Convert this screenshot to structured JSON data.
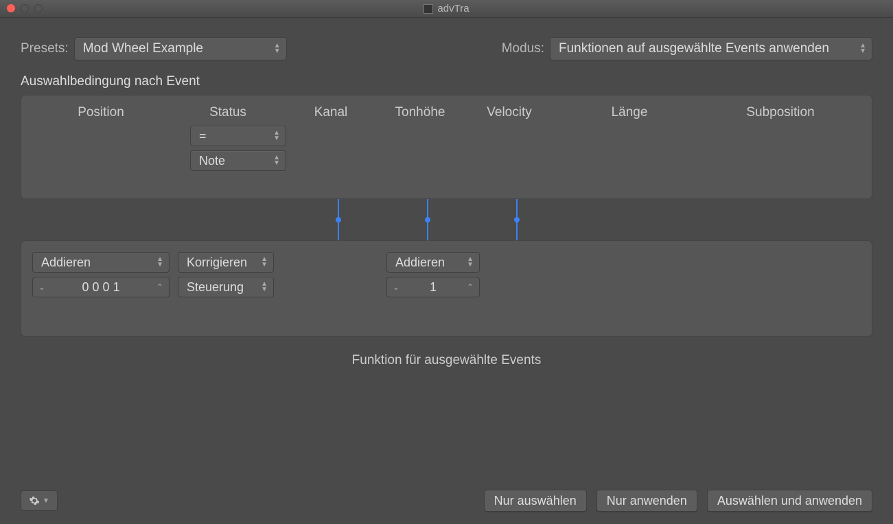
{
  "window": {
    "title": "advTra"
  },
  "toprow": {
    "presets_label": "Presets:",
    "preset_value": "Mod Wheel Example",
    "modus_label": "Modus:",
    "modus_value": "Funktionen auf ausgewählte Events anwenden"
  },
  "condition": {
    "section_label": "Auswahlbedingung nach Event",
    "headers": {
      "position": "Position",
      "status": "Status",
      "kanal": "Kanal",
      "tonhoehe": "Tonhöhe",
      "velocity": "Velocity",
      "laenge": "Länge",
      "subposition": "Subposition"
    },
    "status_op": "=",
    "status_value": "Note"
  },
  "operations": {
    "col1": {
      "op": "Addieren",
      "value": "0 0 0     1"
    },
    "col2": {
      "op": "Korrigieren",
      "value": "Steuerung"
    },
    "col3": {
      "op": "Addieren",
      "value": "1"
    }
  },
  "middle_label": "Funktion für ausgewählte Events",
  "footer": {
    "select_only": "Nur auswählen",
    "apply_only": "Nur anwenden",
    "select_and_apply": "Auswählen und anwenden"
  }
}
